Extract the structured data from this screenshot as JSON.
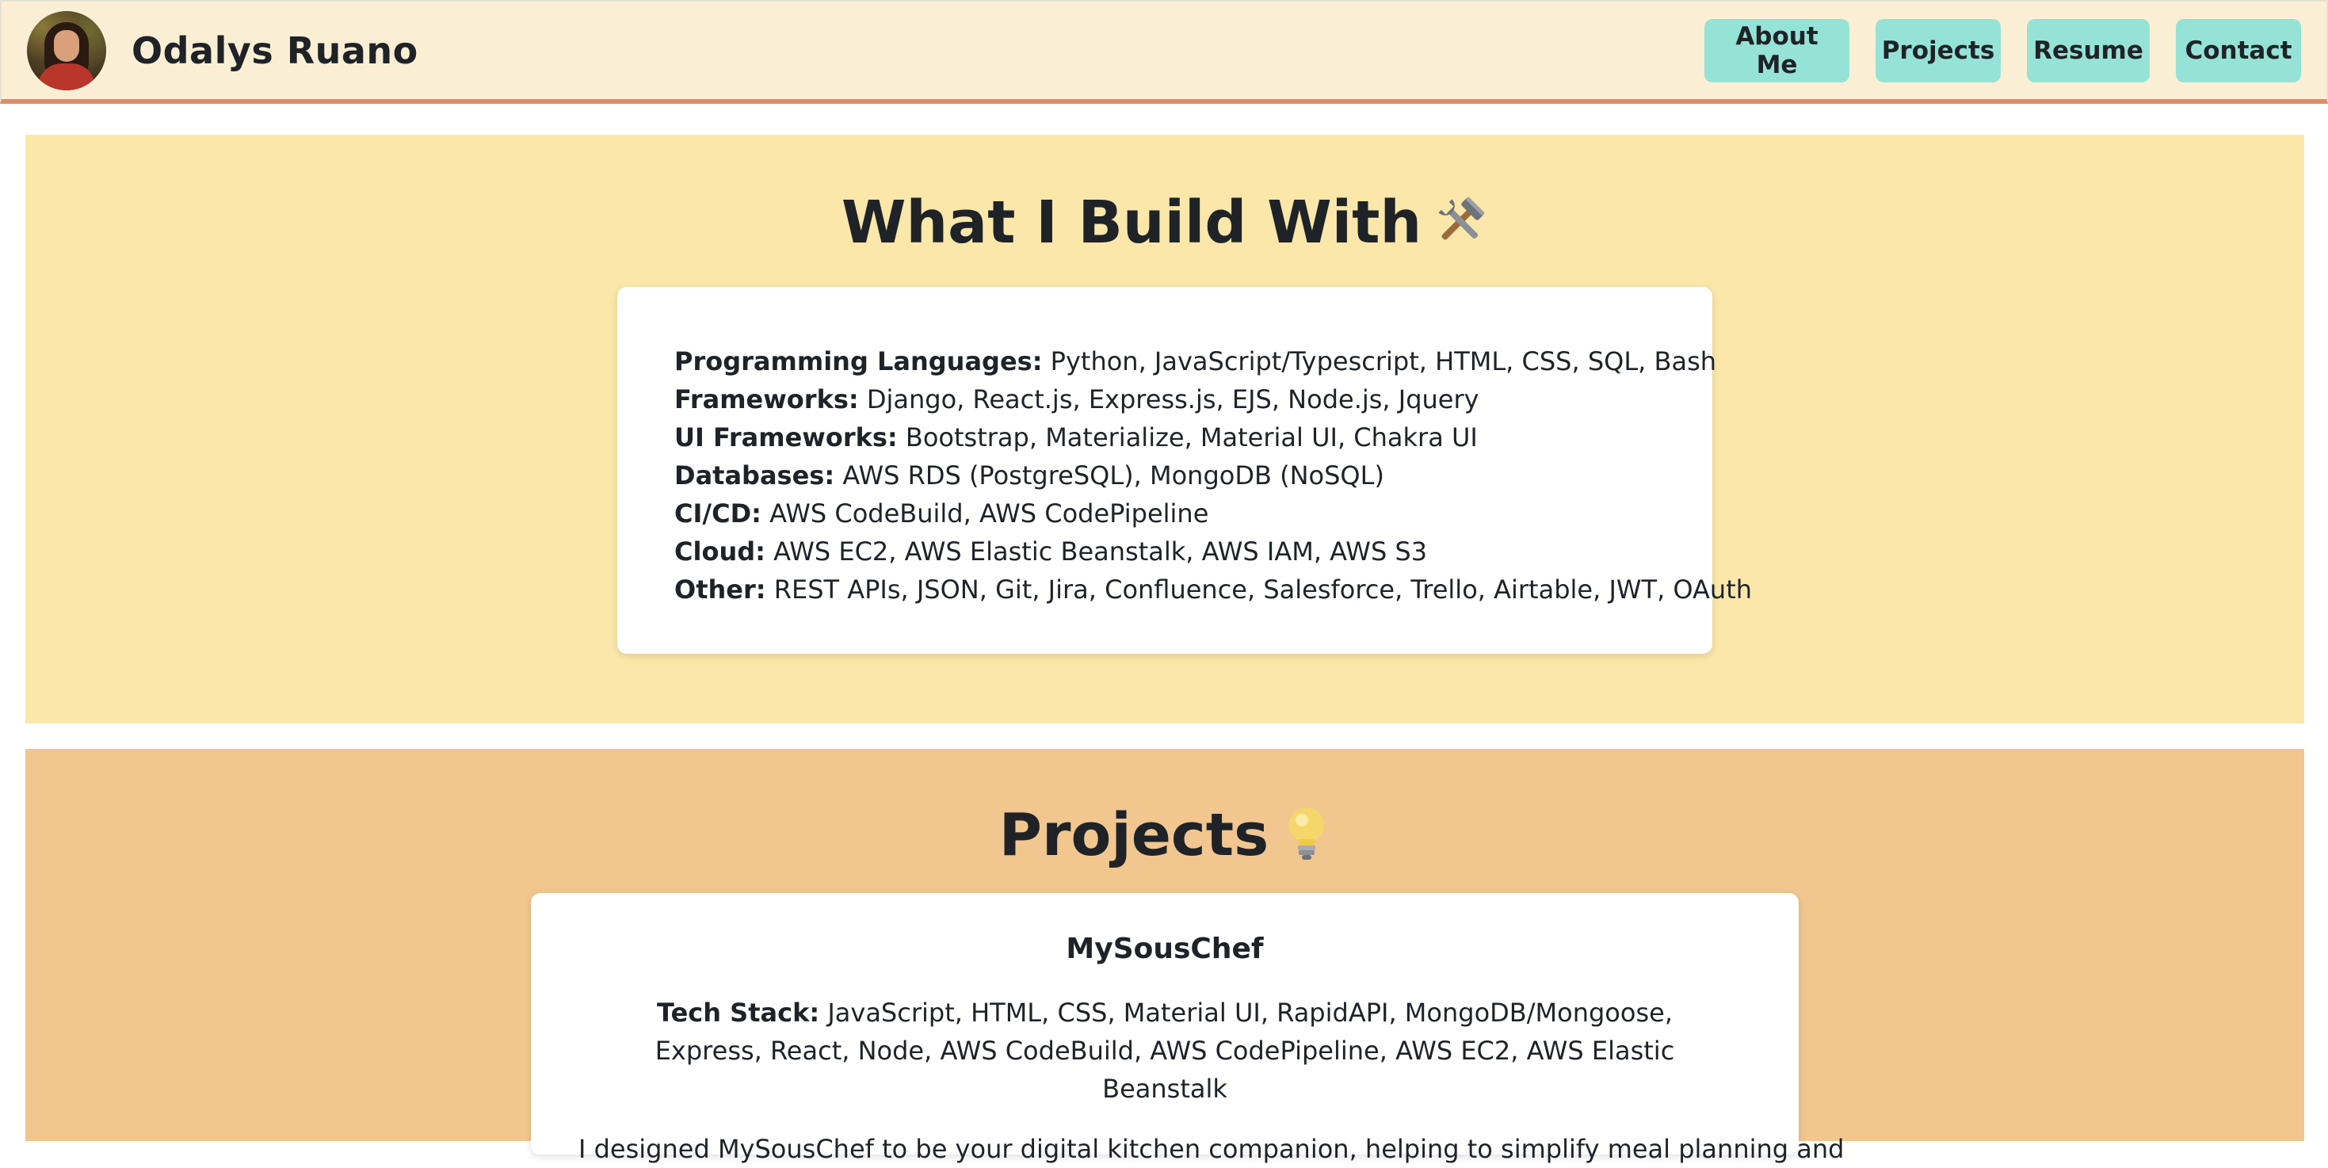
{
  "header": {
    "site_title": "Odalys Ruano",
    "avatar_icon": "profile-photo",
    "nav": [
      {
        "label": "About Me"
      },
      {
        "label": "Projects"
      },
      {
        "label": "Resume"
      },
      {
        "label": "Contact"
      }
    ]
  },
  "skills": {
    "title": "What I Build With",
    "title_icon": "hammer-and-wrench-icon",
    "rows": [
      {
        "label": "Programming Languages:",
        "value": " Python, JavaScript/Typescript, HTML, CSS, SQL, Bash"
      },
      {
        "label": "Frameworks:",
        "value": " Django, React.js, Express.js, EJS, Node.js, Jquery"
      },
      {
        "label": "UI Frameworks:",
        "value": " Bootstrap, Materialize, Material UI, Chakra UI"
      },
      {
        "label": "Databases:",
        "value": " AWS RDS (PostgreSQL), MongoDB (NoSQL)"
      },
      {
        "label": "CI/CD:",
        "value": " AWS CodeBuild, AWS CodePipeline"
      },
      {
        "label": "Cloud:",
        "value": " AWS EC2, AWS Elastic Beanstalk, AWS IAM, AWS S3"
      },
      {
        "label": "Other:",
        "value": " REST APIs, JSON, Git, Jira, Confluence, Salesforce, Trello, Airtable, JWT, OAuth"
      }
    ]
  },
  "projects": {
    "title": "Projects",
    "title_icon": "light-bulb-icon",
    "items": [
      {
        "name": "MySousChef",
        "tech_label": "Tech Stack:",
        "tech_value": " JavaScript, HTML, CSS, Material UI, RapidAPI, MongoDB/Mongoose, Express, React, Node, AWS CodeBuild, AWS CodePipeline, AWS EC2, AWS Elastic Beanstalk",
        "description": "I designed MySousChef to be your digital kitchen companion, helping to simplify meal planning and"
      }
    ]
  },
  "colors": {
    "header_bg": "#faefd4",
    "header_border": "#e08a6b",
    "nav_button": "#95e3d6",
    "skills_bg": "#fae7a9",
    "projects_bg": "#f1c68f",
    "text": "#1f2328"
  }
}
